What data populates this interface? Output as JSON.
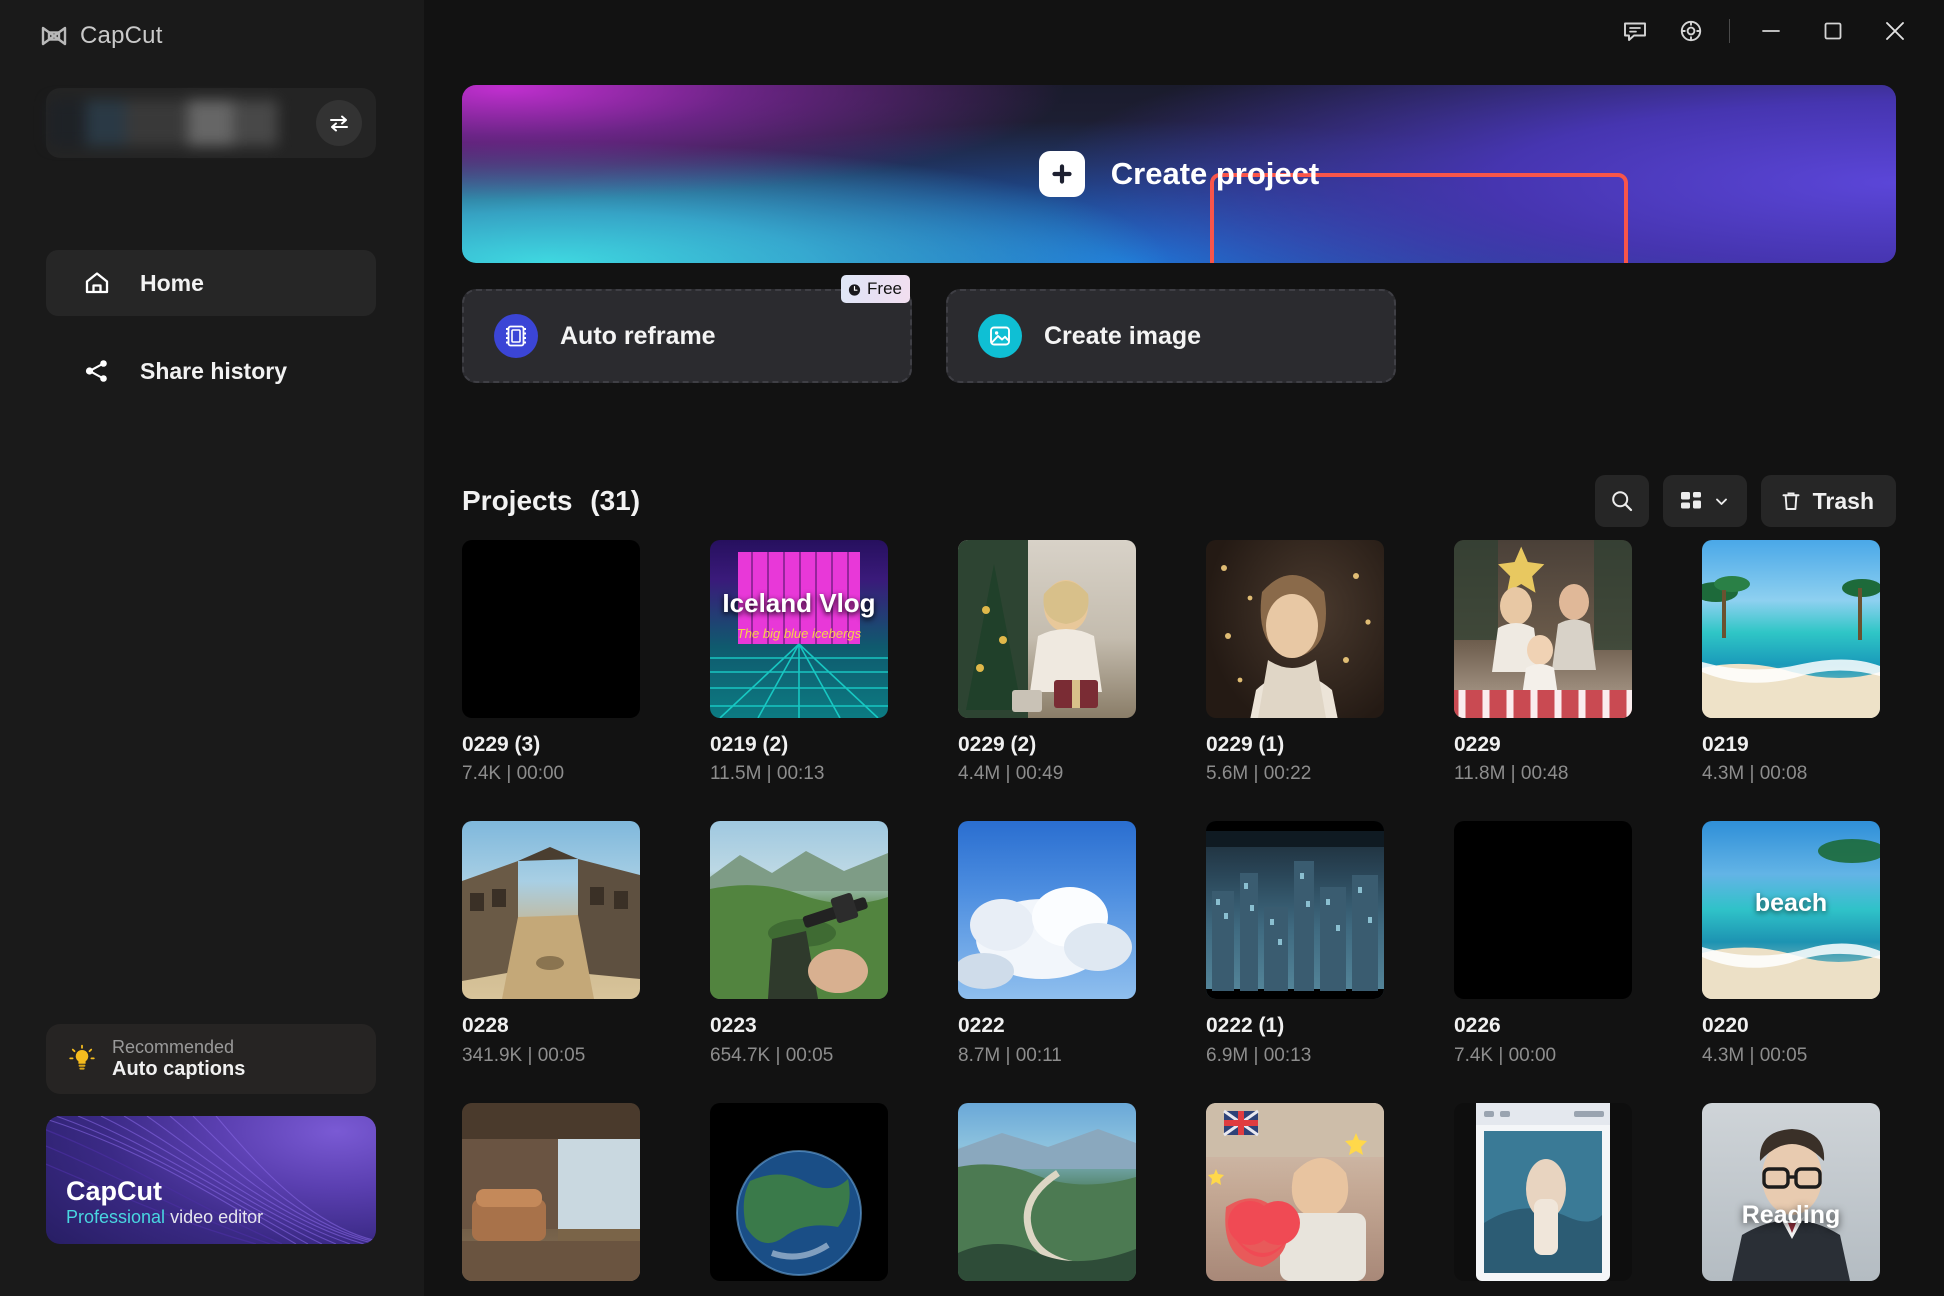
{
  "app": {
    "brand": "CapCut"
  },
  "titlebar": {
    "feedback_icon": "comment-icon",
    "settings_icon": "gear-icon",
    "minimize_icon": "minimize-icon",
    "maximize_icon": "maximize-icon",
    "close_icon": "close-icon"
  },
  "sidebar": {
    "account": {
      "switch_icon": "switch-account-icon",
      "name_masked": ""
    },
    "nav": [
      {
        "label": "Home",
        "icon": "home-icon",
        "active": true
      },
      {
        "label": "Share history",
        "icon": "share-icon",
        "active": false
      }
    ],
    "recommended": {
      "icon": "lightbulb-icon",
      "eyebrow": "Recommended",
      "title": "Auto captions"
    },
    "promo": {
      "title": "CapCut",
      "subtitle_highlight": "Professional",
      "subtitle_rest": " video editor"
    }
  },
  "banner": {
    "create_project_label": "Create project",
    "plus_icon": "plus-icon",
    "highlight_color": "#f8554a"
  },
  "action_cards": [
    {
      "label": "Auto reframe",
      "icon": "auto-reframe-icon",
      "icon_color": "#3b45d6",
      "badge": "Free",
      "badge_icon": "clock-icon"
    },
    {
      "label": "Create image",
      "icon": "image-icon",
      "icon_color": "#0fbfd4",
      "badge": null,
      "badge_icon": null
    }
  ],
  "projects": {
    "heading": "Projects",
    "count_label": "(31)",
    "tools": {
      "search_icon": "search-icon",
      "view_icon": "grid-view-icon",
      "view_chevron_icon": "chevron-down-icon",
      "trash_label": "Trash",
      "trash_icon": "trash-icon"
    },
    "items": [
      {
        "name": "0229 (3)",
        "meta": "7.4K | 00:00",
        "thumb": "black"
      },
      {
        "name": "0219 (2)",
        "meta": "11.5M | 00:13",
        "thumb": "iceland-vlog",
        "caption": "Iceland Vlog"
      },
      {
        "name": "0229 (2)",
        "meta": "4.4M | 00:49",
        "thumb": "christmas-gift"
      },
      {
        "name": "0229 (1)",
        "meta": "5.6M | 00:22",
        "thumb": "woman-tree"
      },
      {
        "name": "0229",
        "meta": "11.8M | 00:48",
        "thumb": "family-christmas"
      },
      {
        "name": "0219",
        "meta": "4.3M | 00:08",
        "thumb": "beach-palms"
      },
      {
        "name": "0228",
        "meta": "341.9K | 00:05",
        "thumb": "game-village"
      },
      {
        "name": "0223",
        "meta": "654.7K | 00:05",
        "thumb": "game-field"
      },
      {
        "name": "0222",
        "meta": "8.7M | 00:11",
        "thumb": "clouds"
      },
      {
        "name": "0222 (1)",
        "meta": "6.9M | 00:13",
        "thumb": "city-skyline"
      },
      {
        "name": "0226",
        "meta": "7.4K | 00:00",
        "thumb": "black"
      },
      {
        "name": "0220",
        "meta": "4.3M | 00:05",
        "thumb": "beach-caption",
        "caption": "beach"
      },
      {
        "name": "",
        "meta": "",
        "thumb": "living-room"
      },
      {
        "name": "",
        "meta": "",
        "thumb": "earth"
      },
      {
        "name": "",
        "meta": "",
        "thumb": "coast-road"
      },
      {
        "name": "",
        "meta": "",
        "thumb": "heart-room"
      },
      {
        "name": "",
        "meta": "",
        "thumb": "phone-person"
      },
      {
        "name": "",
        "meta": "",
        "thumb": "reading-man",
        "caption": "Reading"
      }
    ]
  }
}
